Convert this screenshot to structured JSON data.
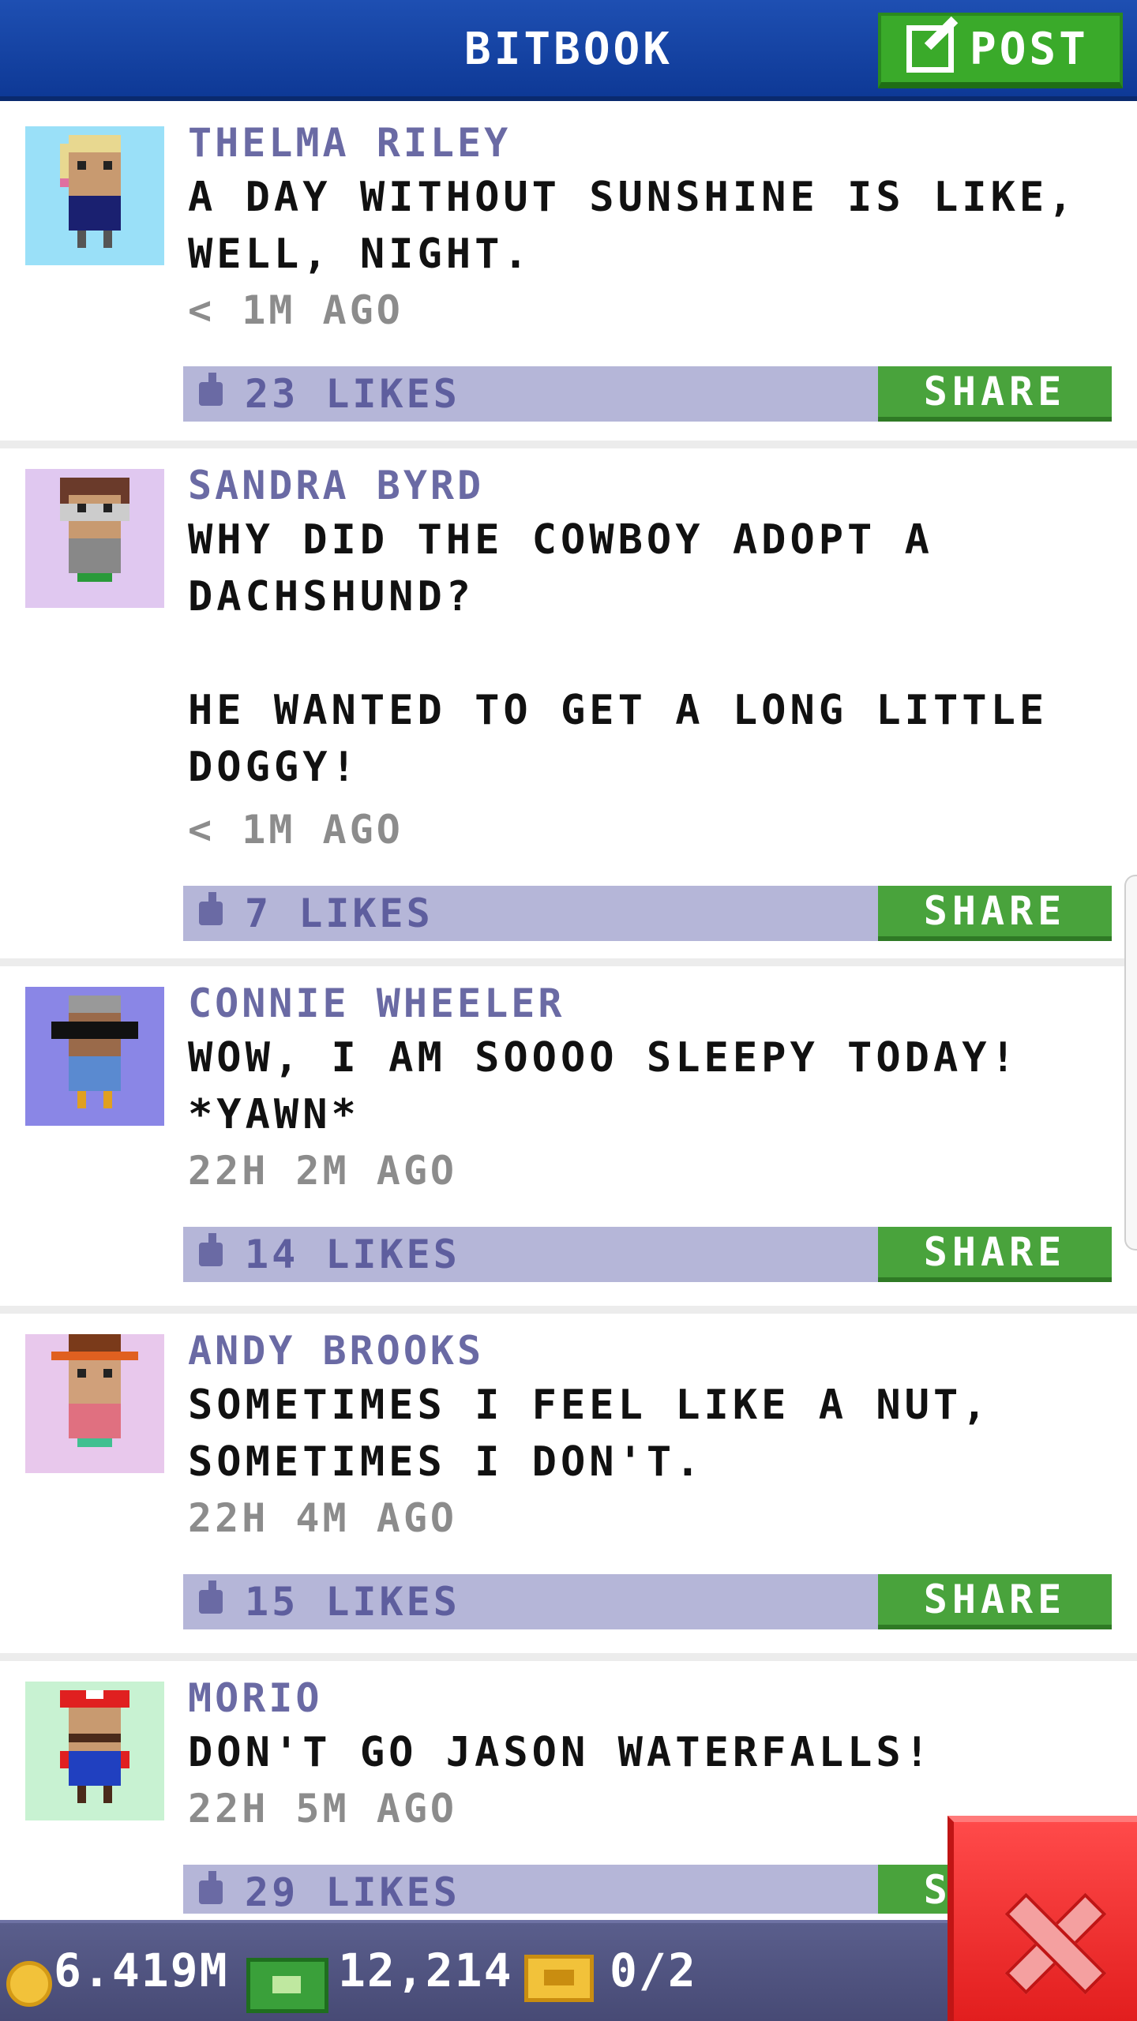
{
  "header": {
    "title": "BITBOOK",
    "post_label": "POST"
  },
  "posts": [
    {
      "name": "THELMA RILEY",
      "text": "A DAY WITHOUT SUNSHINE IS LIKE,\nWELL, NIGHT.",
      "time": "< 1M AGO",
      "likes": "23 LIKES",
      "share": "SHARE",
      "avatar_bg": "#9ae0f8"
    },
    {
      "name": "SANDRA BYRD",
      "text": "WHY DID THE COWBOY ADOPT A\nDACHSHUND?\n\nHE WANTED TO GET A LONG LITTLE\nDOGGY!",
      "time": "< 1M AGO",
      "likes": "7 LIKES",
      "share": "SHARE",
      "avatar_bg": "#e0c8f0"
    },
    {
      "name": "CONNIE WHEELER",
      "text": "WOW, I AM SOOOO SLEEPY TODAY!\n*YAWN*",
      "time": "22H 2M AGO",
      "likes": "14 LIKES",
      "share": "SHARE",
      "avatar_bg": "#8a86e6"
    },
    {
      "name": "ANDY BROOKS",
      "text": "SOMETIMES I FEEL LIKE A NUT,\nSOMETIMES I DON'T.",
      "time": "22H 4M AGO",
      "likes": "15 LIKES",
      "share": "SHARE",
      "avatar_bg": "#e8c8ec"
    },
    {
      "name": "MORIO",
      "text": "DON'T GO JASON WATERFALLS!",
      "time": "22H 5M AGO",
      "likes": "29 LIKES",
      "share": "SHARE",
      "avatar_bg": "#c8f2d2"
    }
  ],
  "bottom_bar": {
    "coins": "6.419M",
    "cash": "12,214",
    "tickets": "0/2"
  },
  "colors": {
    "header": "#1e4fb2",
    "post_button": "#3aaa2a",
    "like_bar": "#b5b6d8",
    "share_button": "#49a33c",
    "close_button": "#e21e1e"
  },
  "icons": [
    "edit-icon",
    "thumbs-up-icon",
    "coin-icon",
    "cash-icon",
    "ticket-icon",
    "close-icon"
  ]
}
